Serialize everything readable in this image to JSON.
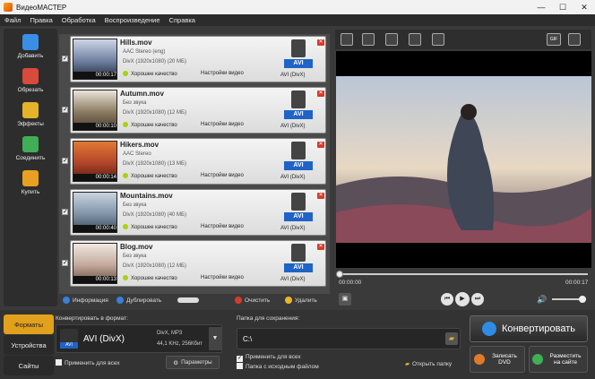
{
  "window": {
    "title": "ВидеоМАСТЕР",
    "minimize_glyph": "—",
    "maximize_glyph": "☐",
    "close_glyph": "✕"
  },
  "menu": [
    "Файл",
    "Правка",
    "Обработка",
    "Воспроизведение",
    "Справка"
  ],
  "tools": [
    {
      "label": "Добавить",
      "icon": "add-film-icon",
      "color": "#3a8ee6"
    },
    {
      "label": "Обрезать",
      "icon": "cut-film-icon",
      "color": "#d84a3a"
    },
    {
      "label": "Эффекты",
      "icon": "effects-icon",
      "color": "#e4b32a"
    },
    {
      "label": "Соединить",
      "icon": "join-icon",
      "color": "#3fae55"
    },
    {
      "label": "Купить",
      "icon": "cart-icon",
      "color": "#e8a020"
    }
  ],
  "files": [
    {
      "name": "Hills.mov",
      "duration": "00:00:17",
      "audio": "AAC Stereo (eng)",
      "video": "DivX (1920x1080) (20 МБ)",
      "quality": "Хорошее качество",
      "settings": "Настройки видео",
      "format": "AVI (DivX)",
      "avi": "AVI",
      "checked": "✓",
      "thumb_colors": [
        "#cdd6e6",
        "#6f7fa0",
        "#222a3a"
      ]
    },
    {
      "name": "Autumn.mov",
      "duration": "00:00:10",
      "audio": "Без звука",
      "video": "DivX (1920x1080) (12 МБ)",
      "quality": "Хорошее качество",
      "settings": "Настройки видео",
      "format": "AVI (DivX)",
      "avi": "AVI",
      "checked": "✓",
      "thumb_colors": [
        "#e9e4d8",
        "#8a7a62",
        "#4a3c2e"
      ]
    },
    {
      "name": "Hikers.mov",
      "duration": "00:00:14",
      "audio": "AAC Stereo",
      "video": "DivX (1920x1080) (13 МБ)",
      "quality": "Хорошее качество",
      "settings": "Настройки видео",
      "format": "AVI (DivX)",
      "avi": "AVI",
      "checked": "✓",
      "thumb_colors": [
        "#e27a34",
        "#b0442a",
        "#5a1e12"
      ]
    },
    {
      "name": "Mountains.mov",
      "duration": "00:00:40",
      "audio": "Без звука",
      "video": "DivX (1920x1080) (40 МБ)",
      "quality": "Хорошее качество",
      "settings": "Настройки видео",
      "format": "AVI (DivX)",
      "avi": "AVI",
      "checked": "✓",
      "thumb_colors": [
        "#c7d3e0",
        "#7f93a8",
        "#3b4a5a"
      ]
    },
    {
      "name": "Blog.mov",
      "duration": "00:00:13",
      "audio": "Без звука",
      "video": "DivX (1920x1080) (12 МБ)",
      "quality": "Хорошее качество",
      "settings": "Настройки видео",
      "format": "AVI (DivX)",
      "avi": "AVI",
      "checked": "✓",
      "thumb_colors": [
        "#f0e8e0",
        "#c2a89a",
        "#6a5048"
      ]
    }
  ],
  "list_tools": {
    "info": "Информация",
    "duplicate": "Дублировать",
    "clear": "Очистить",
    "delete": "Удалить"
  },
  "player": {
    "gif": "GIF",
    "time_start": "00:00:00",
    "time_end": "00:00:17",
    "progress": 0.0
  },
  "tabs": [
    "Форматы",
    "Устройства",
    "Сайты"
  ],
  "convert": {
    "label": "Конвертировать в формат:",
    "format": "AVI (DivX)",
    "format_badge": "AVI",
    "codec": "DivX, MP3",
    "params": "44,1 KHz, 256Кбит",
    "apply_all": "Применить для всех",
    "settings": "Параметры"
  },
  "save": {
    "label": "Папка для сохранения:",
    "path": "C:\\",
    "apply_all": "Применить для всех",
    "source_folder": "Папка с исходным файлом",
    "open_folder": "Открыть папку"
  },
  "actions": {
    "convert": "Конвертировать",
    "dvd": "Записать DVD",
    "web": "Разместить на сайте"
  }
}
